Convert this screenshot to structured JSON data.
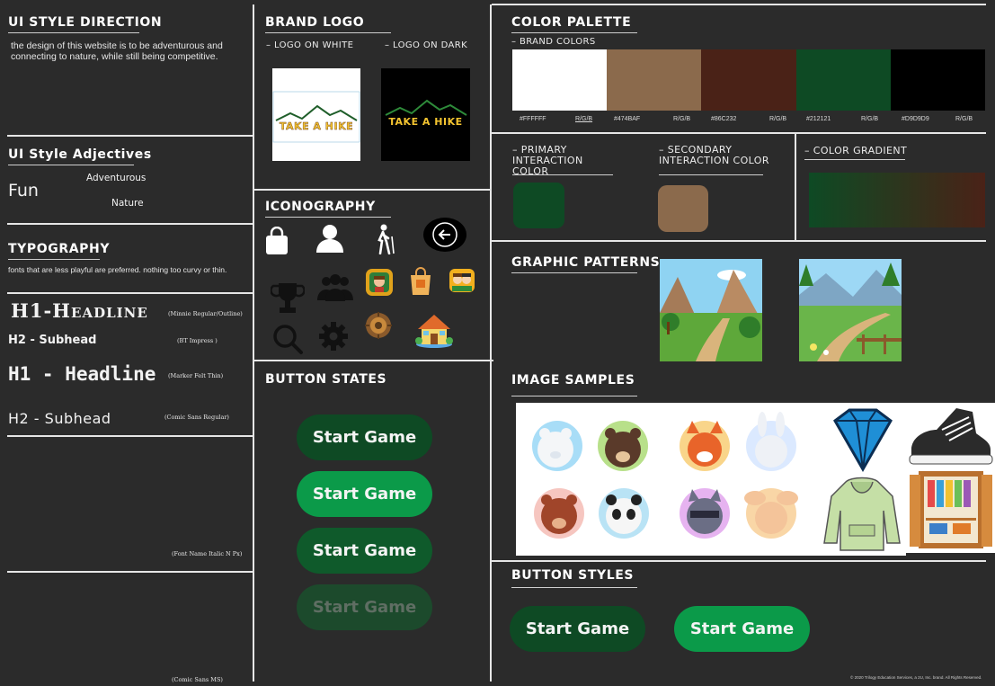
{
  "style_direction": {
    "title": "UI STYLE DIRECTION",
    "description": "the design of this website is to be adventurous and connecting to nature, while still being competitive."
  },
  "adjectives": {
    "title": "UI Style Adjectives",
    "fun": "Fun",
    "adventurous": "Adventurous",
    "nature": "Nature"
  },
  "typography": {
    "title": "TYPOGRAPHY",
    "note": "fonts that are less playful are preferred. nothing too curvy or thin.",
    "samples": [
      {
        "text": "H1-Headline",
        "font": "(Minnie Regular/Outline)"
      },
      {
        "text": "H2 - Subhead",
        "font": "(BT Impress )"
      },
      {
        "text": "H1 - Headline",
        "font": "(Marker Felt Thin)"
      },
      {
        "text": "H2 - Subhead",
        "font": "(Comic Sans Regular)"
      }
    ],
    "font_placeholder": "(Font Name Italic N Px)",
    "font_last": "(Comic Sans MS)"
  },
  "brand_logo": {
    "title": "BRAND LOGO",
    "on_white": "– LOGO ON WHITE",
    "on_dark": "– LOGO ON DARK",
    "logo_text": "TAKE A HIKE"
  },
  "iconography": {
    "title": "ICONOGRAPHY",
    "icons": [
      "shopping-bag-icon",
      "user-icon",
      "hiker-icon",
      "back-arrow-icon",
      "trophy-icon",
      "group-icon",
      "character-badge-icon",
      "shop-bag-icon",
      "friends-icon",
      "search-icon",
      "settings-icon",
      "gear-badge-icon",
      "house-icon"
    ]
  },
  "button_states": {
    "title": "BUTTON STATES",
    "labels": [
      "Start Game",
      "Start Game",
      "Start Game",
      "Start Game"
    ]
  },
  "color_palette": {
    "title": "COLOR PALETTE",
    "brand_colors_label": "– BRAND COLORS",
    "swatches": [
      {
        "color": "#FFFFFF",
        "hex": "#FFFFFF",
        "rgb": "R/G/B"
      },
      {
        "color": "#8B6A4C",
        "hex": "#474BAF",
        "rgb": "R/G/B"
      },
      {
        "color": "#4A2217",
        "hex": "#86C232",
        "rgb": "R/G/B"
      },
      {
        "color": "#0E4A24",
        "hex": "#212121",
        "rgb": "R/G/B"
      },
      {
        "color": "#000000",
        "hex": "#D9D9D9",
        "rgb": "R/G/B"
      }
    ],
    "primary_label": "– PRIMARY INTERACTION COLOR",
    "primary_color": "#0E4A24",
    "secondary_label": "– SECONDARY INTERACTION COLOR",
    "secondary_color": "#8B6A4C",
    "gradient_label": "– COLOR GRADIENT",
    "gradient_from": "#0E4A24",
    "gradient_to": "#4A2217"
  },
  "graphic_patterns": {
    "title": "GRAPHIC PATTERNS"
  },
  "image_samples": {
    "title": "IMAGE SAMPLES"
  },
  "button_styles": {
    "title": "BUTTON STYLES",
    "labels": [
      "Start Game",
      "Start Game"
    ]
  },
  "footer": {
    "copyright": "© 2020 Trilogy Education Services, a 2U, Inc. brand. All Rights Reserved."
  }
}
